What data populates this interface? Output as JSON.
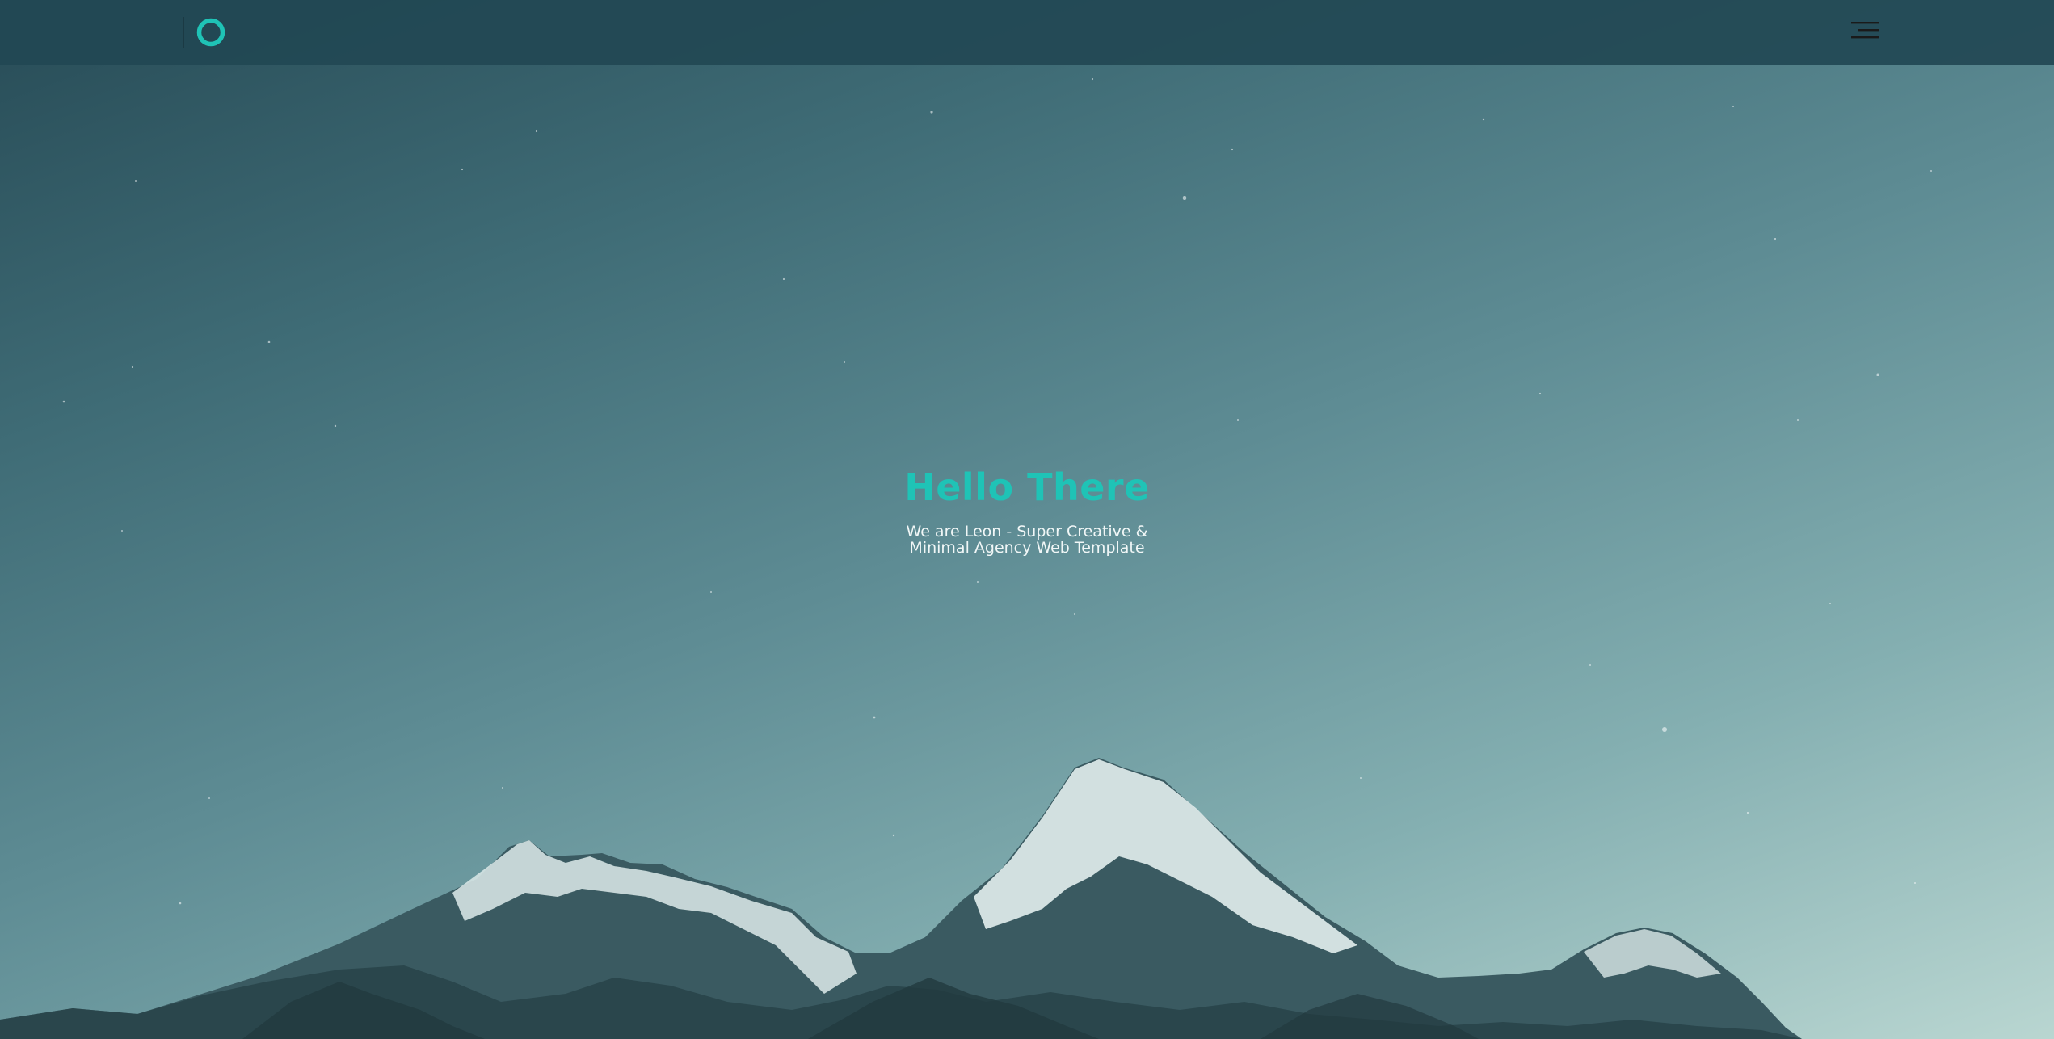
{
  "header": {
    "logo_icon": "leon-circle-logo",
    "menu_icon": "hamburger-menu-icon"
  },
  "hero": {
    "title": "Hello There",
    "subtitle_line1": "We are Leon - Super Creative &",
    "subtitle_line2": "Minimal Agency Web Template"
  },
  "colors": {
    "accent": "#1fc3b6",
    "header_bg": "#224854",
    "sky_top": "#274b56",
    "sky_bottom": "#b9d6d1",
    "text_light": "#f1f7f7"
  }
}
